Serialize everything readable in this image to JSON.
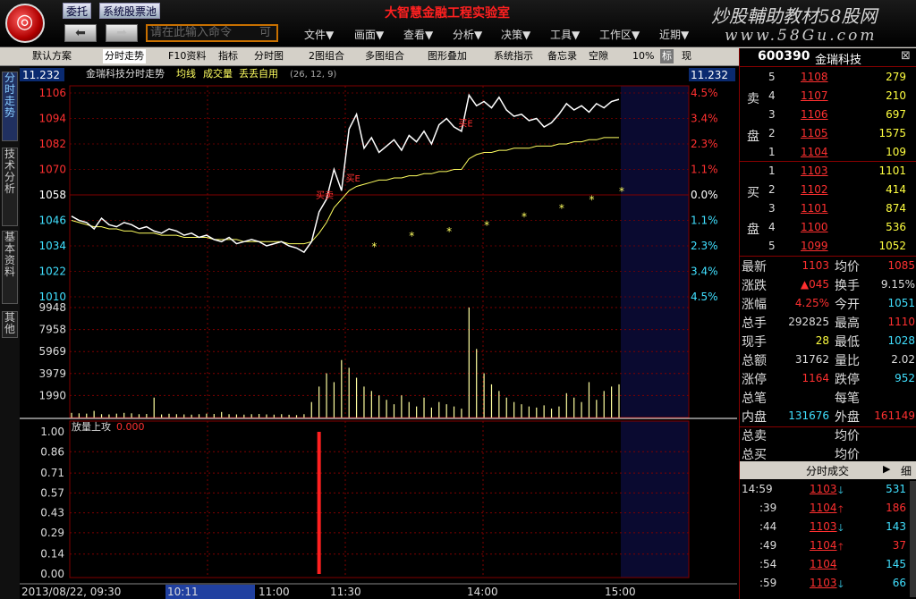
{
  "window": {
    "app_title": "大智慧金融工程实验室",
    "brand": "炒股輔助教材58股网",
    "brand_url": "www.58Gu.com",
    "buttons": {
      "entrust": "委托",
      "stock_pool": "系统股票池"
    },
    "command_placeholder": "请在此输入命令",
    "command_extra": "可",
    "menus": [
      "文件▼",
      "画面▼",
      "查看▼",
      "分析▼",
      "决策▼",
      "工具▼",
      "工作区▼",
      "近期▼"
    ]
  },
  "toolbar": [
    "默认方案",
    "分时走势",
    "F10资料",
    "指标",
    "分时图",
    "2图组合",
    "多图组合",
    "图形叠加",
    "系统指示",
    "备忘录",
    "空隙",
    "10%",
    "标",
    "现"
  ],
  "left_tabs": [
    "分时走势",
    "技术分析",
    "基本资料",
    "其他"
  ],
  "chart": {
    "price_box": "11.232",
    "price_box_right": "11.232",
    "title": "金瑞科技分时走势",
    "legend": {
      "avg": "均线",
      "vol": "成交量",
      "ind": "丢丢自用",
      "params": "(26, 12, 9)"
    },
    "price_labels": [
      "1106",
      "1094",
      "1082",
      "1070",
      "1058",
      "1046",
      "1034",
      "1022",
      "1010"
    ],
    "pct_labels": [
      "4.5%",
      "3.4%",
      "2.3%",
      "1.1%",
      "0.0%",
      "1.1%",
      "2.3%",
      "3.4%",
      "4.5%"
    ],
    "vol_labels": [
      "9948",
      "7958",
      "5969",
      "3979",
      "1990"
    ],
    "marks": [
      "买卖",
      "买E",
      "买E"
    ],
    "sub_title": "放量上攻",
    "sub_value": "0.000",
    "sub_labels": [
      "1.00",
      "0.86",
      "0.71",
      "0.57",
      "0.43",
      "0.29",
      "0.14",
      "0.00"
    ],
    "time_labels": [
      "2013/08/22, 09:30",
      "10:11",
      "11:00",
      "11:30",
      "14:00",
      "15:00"
    ]
  },
  "chart_data": {
    "type": "line",
    "title": "金瑞科技分时走势",
    "ylabel": "",
    "xlabel": "",
    "ylim": [
      1010,
      1106
    ],
    "series": [
      {
        "name": "",
        "values": [
          1048,
          1046,
          1045,
          1042,
          1047,
          1044,
          1043,
          1045,
          1044,
          1042,
          1043,
          1041,
          1040,
          1042,
          1041,
          1039,
          1040,
          1038,
          1039,
          1037,
          1036,
          1038,
          1035,
          1036,
          1037,
          1036,
          1034,
          1035,
          1036,
          1034,
          1033,
          1031,
          1036,
          1050,
          1056,
          1070,
          1060,
          1089,
          1096,
          1080,
          1085,
          1078,
          1081,
          1084,
          1079,
          1086,
          1083,
          1088,
          1082,
          1091,
          1094,
          1090,
          1088,
          1105,
          1100,
          1102,
          1099,
          1104,
          1098,
          1095,
          1096,
          1093,
          1094,
          1090,
          1092,
          1096,
          1101,
          1098,
          1100,
          1097,
          1101,
          1099,
          1102,
          1103
        ]
      },
      {
        "name": "均线",
        "values": [
          1046,
          1045,
          1044,
          1043,
          1043,
          1042,
          1042,
          1041,
          1041,
          1040,
          1040,
          1040,
          1039,
          1039,
          1039,
          1038,
          1038,
          1038,
          1038,
          1037,
          1037,
          1037,
          1037,
          1036,
          1036,
          1036,
          1036,
          1036,
          1036,
          1035,
          1035,
          1035,
          1036,
          1040,
          1045,
          1052,
          1056,
          1060,
          1062,
          1063,
          1064,
          1065,
          1065,
          1066,
          1066,
          1067,
          1067,
          1068,
          1068,
          1069,
          1069,
          1070,
          1070,
          1075,
          1077,
          1078,
          1078,
          1079,
          1079,
          1080,
          1080,
          1080,
          1081,
          1081,
          1081,
          1082,
          1082,
          1083,
          1083,
          1084,
          1084,
          1085,
          1085,
          1085
        ]
      }
    ],
    "volume": [
      420,
      380,
      350,
      600,
      300,
      280,
      350,
      420,
      380,
      300,
      320,
      1800,
      280,
      340,
      300,
      280,
      260,
      300,
      350,
      320,
      500,
      300,
      280,
      260,
      300,
      320,
      280,
      260,
      300,
      250,
      220,
      300,
      1400,
      2800,
      4000,
      3200,
      5200,
      4500,
      3600,
      2800,
      2400,
      2000,
      1600,
      1200,
      2000,
      1400,
      1000,
      1800,
      900,
      1400,
      1200,
      1000,
      800,
      9948,
      6200,
      4000,
      3000,
      2400,
      1800,
      1400,
      1200,
      1000,
      900,
      1100,
      800,
      1000,
      2200,
      1800,
      1400,
      3200,
      1600,
      2400,
      2800,
      3000
    ],
    "signal": [
      0,
      0,
      0,
      0,
      0,
      0,
      0,
      0,
      0,
      0,
      0,
      0,
      0,
      0,
      0,
      0,
      0,
      0,
      0,
      0,
      0,
      0,
      0,
      0,
      0,
      0,
      0,
      0,
      0,
      0,
      0,
      0,
      0,
      1,
      0,
      0,
      0,
      0,
      0,
      0,
      0,
      0,
      0,
      0,
      0,
      0,
      0,
      0,
      0,
      0,
      0,
      0,
      0,
      0,
      0,
      0,
      0,
      0,
      0,
      0,
      0,
      0,
      0,
      0,
      0,
      0,
      0,
      0,
      0,
      0,
      0,
      0,
      0,
      0
    ]
  },
  "quote": {
    "code": "600390",
    "name": "金瑞科技",
    "sell_label": [
      "卖",
      "盘"
    ],
    "buy_label": [
      "买",
      "盘"
    ],
    "sell": [
      {
        "lvl": "5",
        "price": "1108",
        "vol": "279"
      },
      {
        "lvl": "4",
        "price": "1107",
        "vol": "210"
      },
      {
        "lvl": "3",
        "price": "1106",
        "vol": "697"
      },
      {
        "lvl": "2",
        "price": "1105",
        "vol": "1575"
      },
      {
        "lvl": "1",
        "price": "1104",
        "vol": "109"
      }
    ],
    "buy": [
      {
        "lvl": "1",
        "price": "1103",
        "vol": "1101"
      },
      {
        "lvl": "2",
        "price": "1102",
        "vol": "414"
      },
      {
        "lvl": "3",
        "price": "1101",
        "vol": "874"
      },
      {
        "lvl": "4",
        "price": "1100",
        "vol": "536"
      },
      {
        "lvl": "5",
        "price": "1099",
        "vol": "1052"
      }
    ],
    "stats": [
      {
        "k1": "最新",
        "v1": "1103",
        "c1": "red",
        "k2": "均价",
        "v2": "1085",
        "c2": "red"
      },
      {
        "k1": "涨跌",
        "v1": "▲045",
        "c1": "red",
        "k2": "换手",
        "v2": "9.15%",
        "c2": "white"
      },
      {
        "k1": "涨幅",
        "v1": "4.25%",
        "c1": "red",
        "k2": "今开",
        "v2": "1051",
        "c2": "cyan"
      },
      {
        "k1": "总手",
        "v1": "292825",
        "c1": "white",
        "k2": "最高",
        "v2": "1110",
        "c2": "red"
      },
      {
        "k1": "现手",
        "v1": "28",
        "c1": "yellow",
        "k2": "最低",
        "v2": "1028",
        "c2": "cyan"
      },
      {
        "k1": "总额",
        "v1": "31762",
        "c1": "white",
        "k2": "量比",
        "v2": "2.02",
        "c2": "white"
      },
      {
        "k1": "涨停",
        "v1": "1164",
        "c1": "red",
        "k2": "跌停",
        "v2": "952",
        "c2": "cyan"
      },
      {
        "k1": "总笔",
        "v1": "",
        "c1": "white",
        "k2": "每笔",
        "v2": "",
        "c2": "white"
      },
      {
        "k1": "内盘",
        "v1": "131676",
        "c1": "cyan",
        "k2": "外盘",
        "v2": "161149",
        "c2": "red"
      },
      {
        "k1": "总卖",
        "v1": "",
        "c1": "white",
        "k2": "均价",
        "v2": "",
        "c2": "white"
      },
      {
        "k1": "总买",
        "v1": "",
        "c1": "white",
        "k2": "均价",
        "v2": "",
        "c2": "white"
      }
    ],
    "ticks_title": "分时成交",
    "ticks_detail": "细",
    "ticks": [
      {
        "t": "14:59",
        "p": "1103",
        "d": "down",
        "v": "531"
      },
      {
        "t": ":39",
        "p": "1104",
        "d": "up",
        "v": "186"
      },
      {
        "t": ":44",
        "p": "1103",
        "d": "down",
        "v": "143"
      },
      {
        "t": ":49",
        "p": "1104",
        "d": "up",
        "v": "37"
      },
      {
        "t": ":54",
        "p": "1104",
        "d": "",
        "v": "145"
      },
      {
        "t": ":59",
        "p": "1103",
        "d": "down",
        "v": "66"
      }
    ]
  },
  "colors": {
    "up": "#ff3030",
    "down": "#30ff30",
    "avg": "#ffff60",
    "grid": "#800000"
  }
}
